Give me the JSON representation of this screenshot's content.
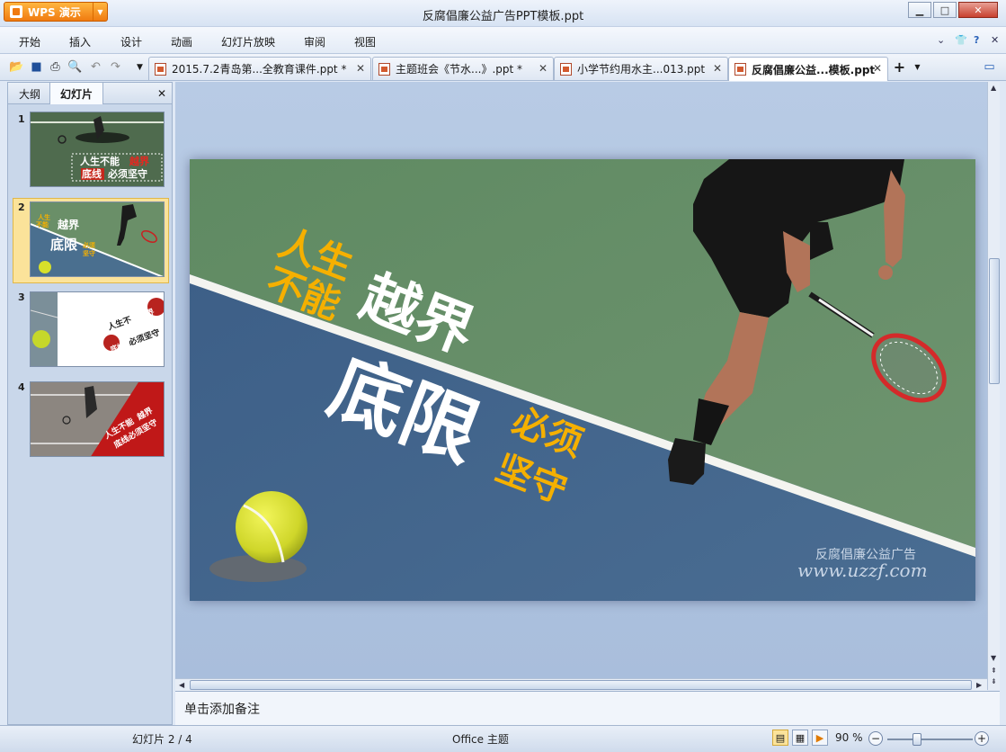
{
  "app": {
    "name": "WPS 演示",
    "window_title": "反腐倡廉公益广告PPT模板.ppt"
  },
  "menu": [
    "开始",
    "插入",
    "设计",
    "动画",
    "幻灯片放映",
    "审阅",
    "视图"
  ],
  "tabs": [
    {
      "label": "2015.7.2青岛第...全教育课件.ppt *",
      "active": false
    },
    {
      "label": "主题班会《节水...》.ppt *",
      "active": false
    },
    {
      "label": "小学节约用水主...013.ppt",
      "active": false
    },
    {
      "label": "反腐倡廉公益...模板.ppt",
      "active": true
    }
  ],
  "left_panel": {
    "tabs": [
      "大纲",
      "幻灯片"
    ],
    "slides": [
      {
        "number": "1",
        "text1": "人生不能",
        "text2": "越界",
        "text3": "底线",
        "text4": "必须坚守"
      },
      {
        "number": "2",
        "text1": "人生",
        "text2": "不能",
        "text3": "越界",
        "text4": "底限",
        "text5": "必须",
        "text6": "坚守"
      },
      {
        "number": "3",
        "text1": "人生不",
        "text2": "越界",
        "text3": "底线",
        "text4": "必须坚守"
      },
      {
        "number": "4",
        "text1": "人生不能",
        "text2": "越界",
        "text3": "底线必须坚守"
      }
    ]
  },
  "slide": {
    "line1": "人生",
    "line2": "不能",
    "line3": "越界",
    "line4": "底限",
    "line5": "必须",
    "line6": "坚守",
    "caption": "反腐倡廉公益广告",
    "watermark": "www.uzzf.com",
    "colors": {
      "court_top": "#6a8f68",
      "court_bottom": "#3f6285",
      "accent_yellow": "#f5b000",
      "white": "#ffffff"
    }
  },
  "notes_placeholder": "单击添加备注",
  "status": {
    "slide_info": "幻灯片 2 / 4",
    "theme": "Office 主题",
    "zoom": "90 %"
  },
  "icons": [
    "open-icon",
    "save-icon",
    "print-icon",
    "print-preview-icon",
    "undo-icon",
    "redo-icon",
    "dropdown-icon",
    "new-tab-icon",
    "help-icon",
    "skin-icon",
    "minimize-icon",
    "maximize-icon",
    "close-icon"
  ]
}
